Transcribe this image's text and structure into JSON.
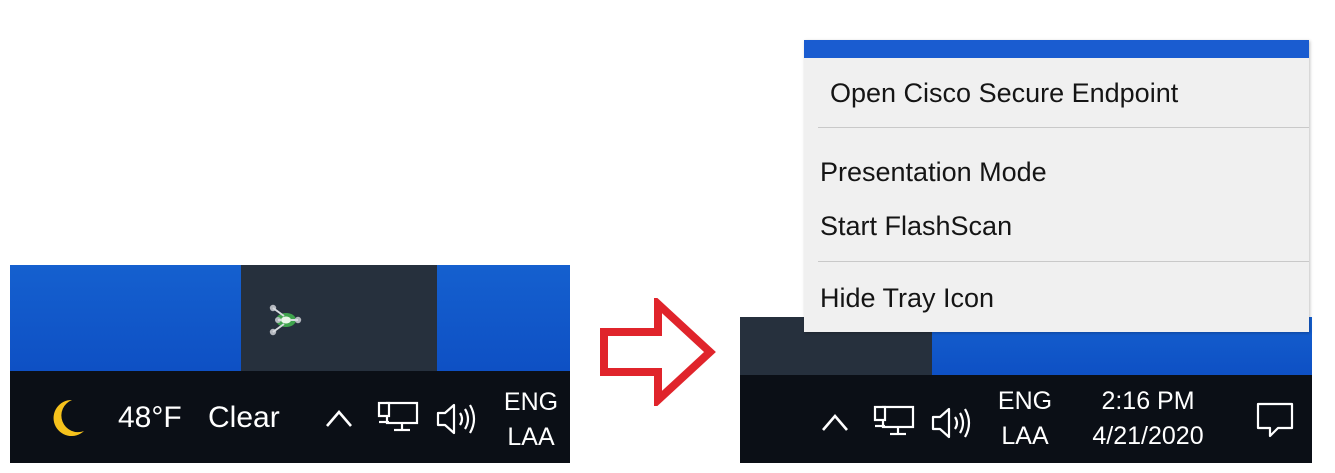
{
  "left_taskbar": {
    "weather_icon": "crescent-moon-icon",
    "temperature": "48°F",
    "condition": "Clear",
    "tray_icons": [
      "chevron-up-icon",
      "network-icon",
      "speaker-icon"
    ],
    "language_top": "ENG",
    "language_bottom": "LAA"
  },
  "overflow_icon": "cisco-secure-endpoint-icon",
  "arrow": {
    "color": "#e0242b",
    "icon": "right-arrow-icon"
  },
  "context_menu": {
    "items": [
      {
        "label": "Open Cisco Secure Endpoint"
      },
      {
        "label": "Presentation Mode"
      },
      {
        "label": "Start FlashScan"
      },
      {
        "label": "Hide Tray Icon"
      }
    ],
    "accent": "#1a5cd0"
  },
  "right_taskbar": {
    "tray_icons": [
      "chevron-up-icon",
      "network-icon",
      "speaker-icon"
    ],
    "language_top": "ENG",
    "language_bottom": "LAA",
    "time": "2:16 PM",
    "date": "4/21/2020",
    "action_center_icon": "notification-icon"
  },
  "colors": {
    "taskbar": "#0b0f16",
    "desktop_blue": "#1560cf",
    "overflow_panel": "#26303d",
    "moon": "#f6c21c"
  }
}
